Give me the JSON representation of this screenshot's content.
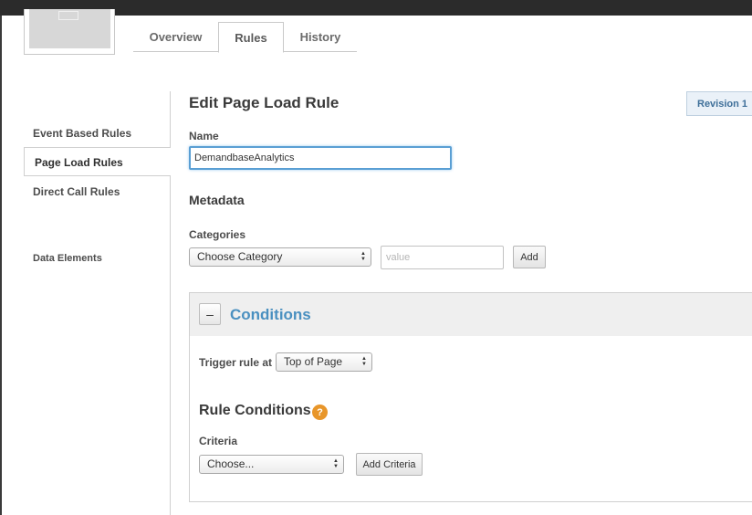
{
  "header": {
    "tabs": [
      {
        "label": "Overview"
      },
      {
        "label": "Rules"
      },
      {
        "label": "History"
      }
    ]
  },
  "sidebar": {
    "items": [
      {
        "label": "Event Based Rules"
      },
      {
        "label": "Page Load Rules",
        "active": true
      },
      {
        "label": "Direct Call Rules"
      },
      {
        "label": "Data Elements"
      }
    ]
  },
  "main": {
    "title": "Edit Page Load Rule",
    "revision": "Revision 1",
    "name_label": "Name",
    "name_value": "DemandbaseAnalytics",
    "metadata_title": "Metadata",
    "categories_label": "Categories",
    "category_select": "Choose Category",
    "value_placeholder": "value",
    "add_label": "Add",
    "conditions": {
      "collapse_symbol": "–",
      "title": "Conditions",
      "trigger_label": "Trigger rule at",
      "trigger_value": "Top of Page",
      "rule_conditions_title": "Rule Conditions",
      "help_symbol": "?",
      "criteria_label": "Criteria",
      "criteria_select": "Choose...",
      "add_criteria_label": "Add Criteria"
    }
  },
  "colors": {
    "accent": "#4a90c0",
    "help_icon": "#e8962a",
    "focus_border": "#5a9fd4"
  }
}
